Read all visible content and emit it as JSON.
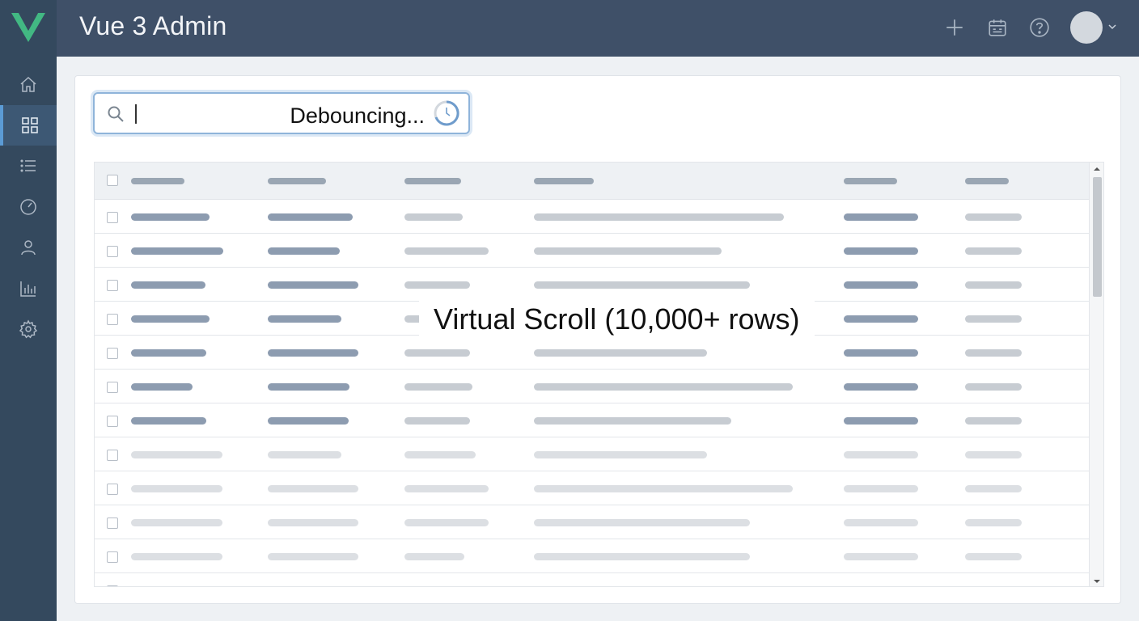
{
  "colors": {
    "sidebar": "#34495e",
    "header": "#3f5068",
    "accent": "#42b883",
    "active_indicator": "#5b9bd5"
  },
  "app": {
    "title": "Vue 3 Admin",
    "logo_icon": "vue-logo"
  },
  "sidebar": {
    "items": [
      {
        "icon": "home-icon",
        "active": false
      },
      {
        "icon": "grid-icon",
        "active": true
      },
      {
        "icon": "list-icon",
        "active": false
      },
      {
        "icon": "gauge-icon",
        "active": false
      },
      {
        "icon": "user-icon",
        "active": false
      },
      {
        "icon": "bar-chart-icon",
        "active": false
      },
      {
        "icon": "gear-icon",
        "active": false
      }
    ]
  },
  "header": {
    "actions": [
      "plus-icon",
      "calendar-icon",
      "help-icon",
      "avatar"
    ]
  },
  "search": {
    "value": "",
    "status": "Debouncing..."
  },
  "table": {
    "overlay_label": "Virtual Scroll (10,000+ rows)",
    "header_cells": 6,
    "loaded_rows": 7,
    "placeholder_rows": 4
  }
}
